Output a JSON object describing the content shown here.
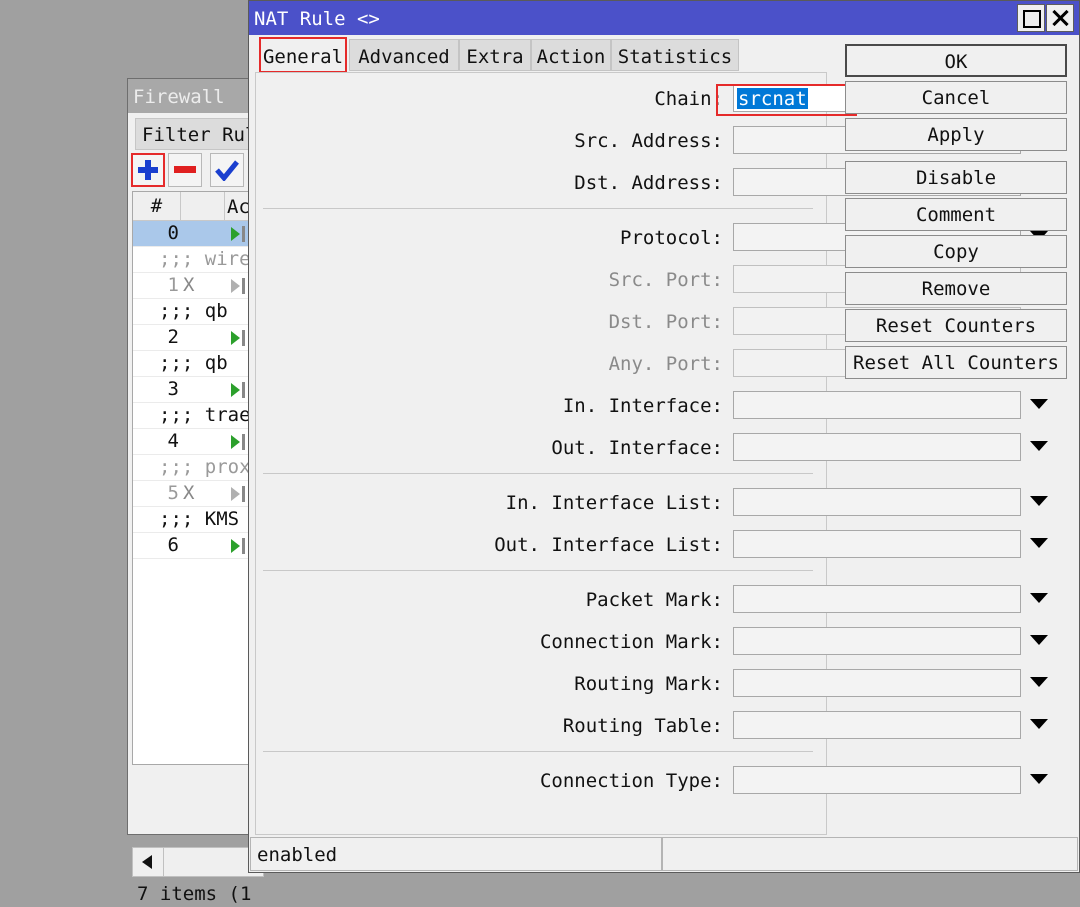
{
  "firewall": {
    "title": "Firewall",
    "tab_label": "Filter Rul",
    "columns": {
      "num": "#",
      "action": "Ac"
    },
    "rows": [
      {
        "type": "rule",
        "num": "0",
        "x": "",
        "state": "enabled",
        "selected": true
      },
      {
        "type": "comment",
        "text": ";;; wire",
        "disabled": true
      },
      {
        "type": "rule",
        "num": "1",
        "x": "X",
        "state": "disabled"
      },
      {
        "type": "comment",
        "text": ";;; qb"
      },
      {
        "type": "rule",
        "num": "2",
        "x": "",
        "state": "enabled"
      },
      {
        "type": "comment",
        "text": ";;; qb"
      },
      {
        "type": "rule",
        "num": "3",
        "x": "",
        "state": "enabled"
      },
      {
        "type": "comment",
        "text": ";;; trae"
      },
      {
        "type": "rule",
        "num": "4",
        "x": "",
        "state": "enabled"
      },
      {
        "type": "comment",
        "text": ";;; prox",
        "disabled": true
      },
      {
        "type": "rule",
        "num": "5",
        "x": "X",
        "state": "disabled"
      },
      {
        "type": "comment",
        "text": ";;; KMS"
      },
      {
        "type": "rule",
        "num": "6",
        "x": "",
        "state": "enabled"
      }
    ],
    "status": "7 items (1"
  },
  "nat_rule": {
    "title": "NAT Rule <>",
    "tabs": [
      "General",
      "Advanced",
      "Extra",
      "Action",
      "Statistics"
    ],
    "active_tab": "General",
    "fields": {
      "chain": {
        "label": "Chain:",
        "value": "srcnat"
      },
      "src_address": {
        "label": "Src. Address:",
        "value": ""
      },
      "dst_address": {
        "label": "Dst. Address:",
        "value": ""
      },
      "protocol": {
        "label": "Protocol:",
        "value": ""
      },
      "src_port": {
        "label": "Src. Port:",
        "value": "",
        "disabled": true
      },
      "dst_port": {
        "label": "Dst. Port:",
        "value": "",
        "disabled": true
      },
      "any_port": {
        "label": "Any. Port:",
        "value": "",
        "disabled": true
      },
      "in_interface": {
        "label": "In. Interface:",
        "value": ""
      },
      "out_interface": {
        "label": "Out. Interface:",
        "value": ""
      },
      "in_interface_list": {
        "label": "In. Interface List:",
        "value": ""
      },
      "out_interface_list": {
        "label": "Out. Interface List:",
        "value": ""
      },
      "packet_mark": {
        "label": "Packet Mark:",
        "value": ""
      },
      "connection_mark": {
        "label": "Connection Mark:",
        "value": ""
      },
      "routing_mark": {
        "label": "Routing Mark:",
        "value": ""
      },
      "routing_table": {
        "label": "Routing Table:",
        "value": ""
      },
      "connection_type": {
        "label": "Connection Type:",
        "value": ""
      }
    },
    "buttons": {
      "ok": "OK",
      "cancel": "Cancel",
      "apply": "Apply",
      "disable": "Disable",
      "comment": "Comment",
      "copy": "Copy",
      "remove": "Remove",
      "reset_counters": "Reset Counters",
      "reset_all_counters": "Reset All Counters"
    },
    "status": "enabled"
  },
  "colors": {
    "title_bar": "#4b51c9",
    "highlight_box": "#e52a2a",
    "selection": "#0078d7",
    "selected_row": "#aac8ea"
  }
}
